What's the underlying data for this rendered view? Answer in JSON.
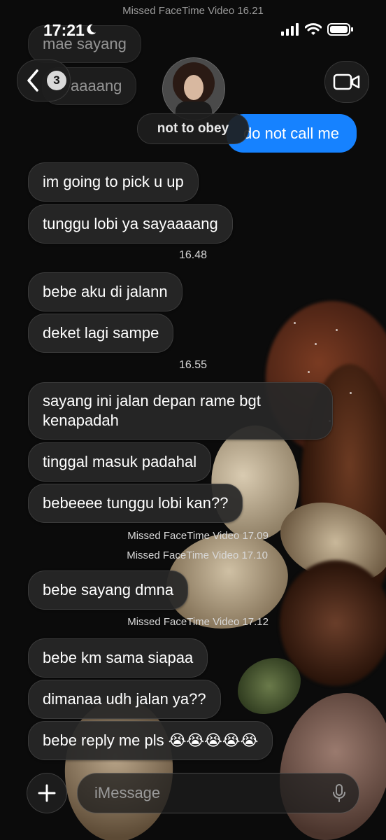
{
  "status_bar": {
    "time": "17:21"
  },
  "header": {
    "missed_top": "Missed FaceTime Video 16.21",
    "back_badge": "3",
    "contact_name": "not to obey"
  },
  "partial_messages": [
    "mae sayang",
    "aaaang"
  ],
  "outgoing": {
    "text": "do not call me"
  },
  "messages": [
    "im going to pick u up",
    "tunggu lobi ya sayaaaang",
    "bebe aku di jalann",
    "deket lagi sampe",
    "sayang ini jalan depan rame bgt\nkenapadah",
    "tinggal masuk padahal",
    "bebeeee tunggu lobi kan??",
    "bebe sayang dmna",
    "bebe km sama siapaa",
    "dimanaa udh jalan ya??",
    "bebe reply me pls 😭😭😭😭😭"
  ],
  "timestamps": [
    "16.48",
    "16.55"
  ],
  "missed_calls": [
    "Missed FaceTime Video 17.09",
    "Missed FaceTime Video 17.10",
    "Missed FaceTime Video 17.12"
  ],
  "composer": {
    "placeholder": "iMessage"
  },
  "colors": {
    "outgoing_bubble": "#1682ff",
    "incoming_bubble": "#282828",
    "background": "#0b0b0b"
  }
}
